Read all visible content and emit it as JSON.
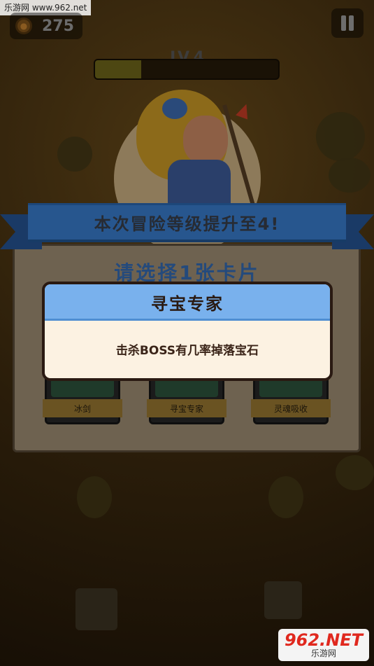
{
  "watermark_top": "乐游网 www.962.net",
  "hud": {
    "coin_icon": "coin-icon",
    "coins": "275",
    "level": "LV.4",
    "xp_progress": 0.25,
    "pause_icon": "pause-icon"
  },
  "banner": {
    "text": "本次冒险等级提升至4!"
  },
  "panel": {
    "title": "请选择1张卡片",
    "cards": [
      {
        "label": "冰剑"
      },
      {
        "label": "寻宝专家"
      },
      {
        "label": "灵魂吸收"
      }
    ]
  },
  "dialog": {
    "title": "寻宝专家",
    "description": "击杀BOSS有几率掉落宝石"
  },
  "watermark_bottom": {
    "logo": "962.NET",
    "sub": "乐游网"
  },
  "colors": {
    "dialog_header": "#79b1ed",
    "dialog_body": "#fcf2e2",
    "ribbon": "#27568e"
  }
}
